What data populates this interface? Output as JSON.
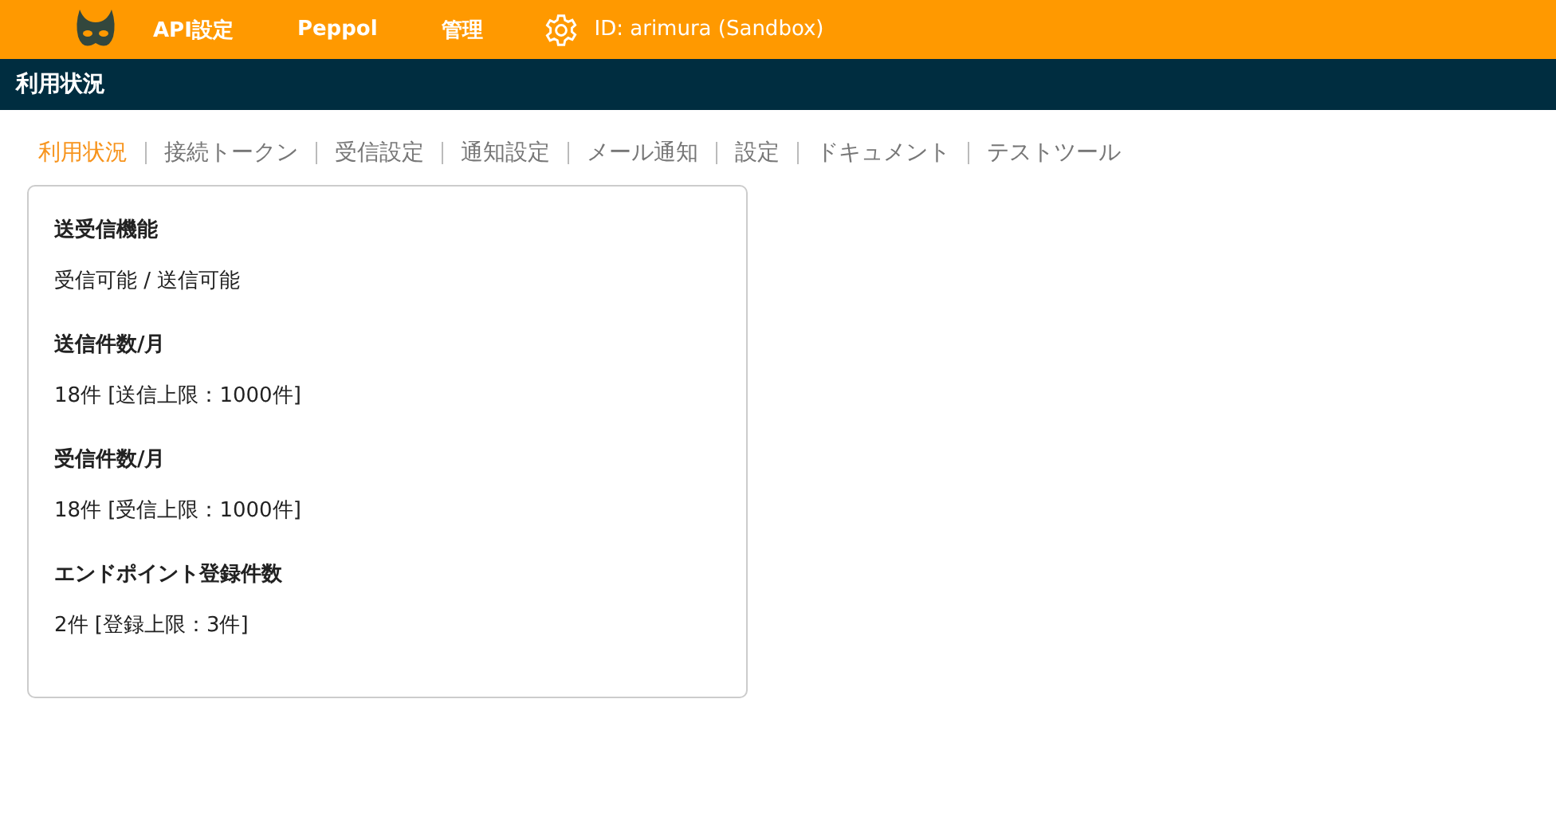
{
  "header": {
    "nav": [
      "API設定",
      "Peppol",
      "管理"
    ],
    "user_id": "ID: arimura (Sandbox)"
  },
  "page_title": "利用状況",
  "tabs": [
    {
      "label": "利用状況",
      "selected": true
    },
    {
      "label": "接続トークン",
      "selected": false
    },
    {
      "label": "受信設定",
      "selected": false
    },
    {
      "label": "通知設定",
      "selected": false
    },
    {
      "label": "メール通知",
      "selected": false
    },
    {
      "label": "設定",
      "selected": false
    },
    {
      "label": "ドキュメント",
      "selected": false
    },
    {
      "label": "テストツール",
      "selected": false
    }
  ],
  "card": {
    "items": [
      {
        "label": "送受信機能",
        "value": "受信可能 / 送信可能"
      },
      {
        "label": "送信件数/月",
        "value": "18件 [送信上限：1000件]"
      },
      {
        "label": "受信件数/月",
        "value": "18件 [受信上限：1000件]"
      },
      {
        "label": "エンドポイント登録件数",
        "value": "2件 [登録上限：3件]"
      }
    ]
  }
}
